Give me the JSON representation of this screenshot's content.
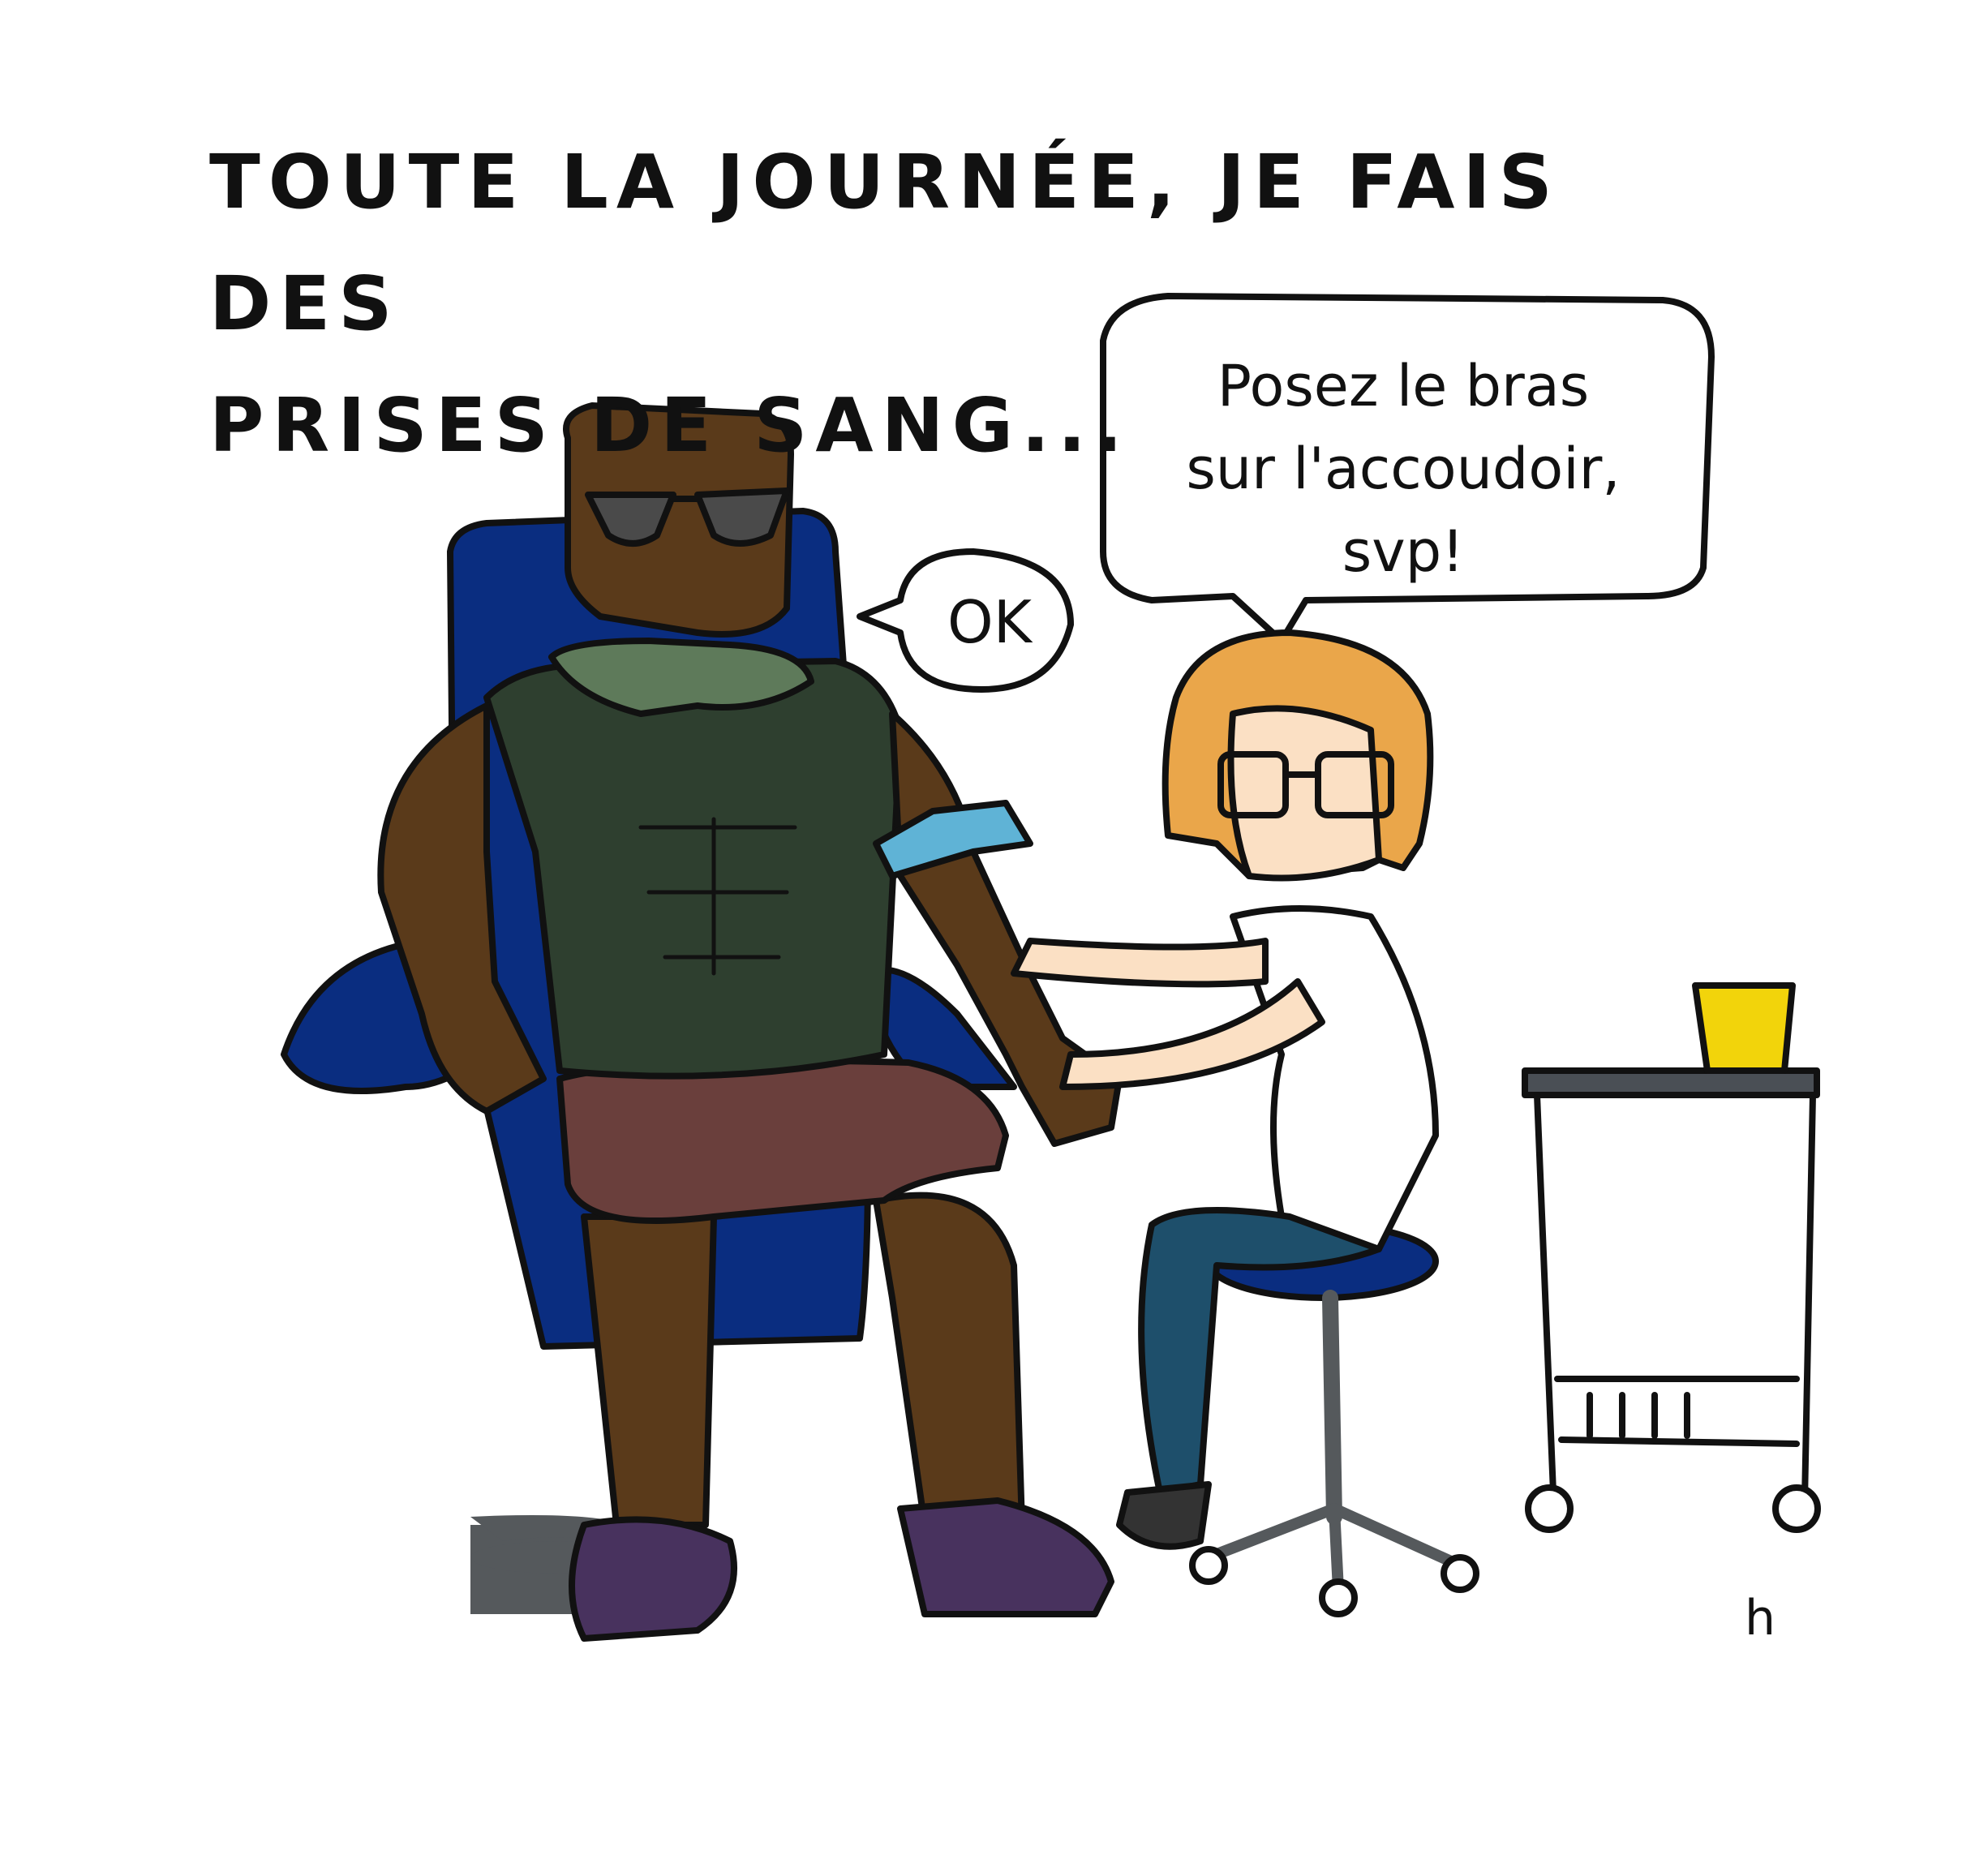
{
  "caption": {
    "line1": "Toute la journée, je fais des",
    "line2": "prises de sang..."
  },
  "patient_bubble": {
    "text": "OK"
  },
  "nurse_bubble": {
    "line1": "Posez le bras",
    "line2": "sur l'accoudoir,",
    "line3": "svp!"
  },
  "signature": {
    "text": "h"
  },
  "colors": {
    "chair": "#0a2d80",
    "skin_patient": "#5a3a1a",
    "vest": "#2e3f2f",
    "vest_collar": "#5e7a5a",
    "shorts": "#6a3f3c",
    "shoes": "#48325e",
    "tourniquet": "#5fb3d6",
    "nurse_hair": "#eaa64a",
    "nurse_skin": "#fbe0c4",
    "nurse_pants": "#1e4f6b",
    "stool_seat": "#0a2d80",
    "cup": "#f2d40b",
    "cart_top": "#4a4f55",
    "chair_base": "#55595c"
  }
}
